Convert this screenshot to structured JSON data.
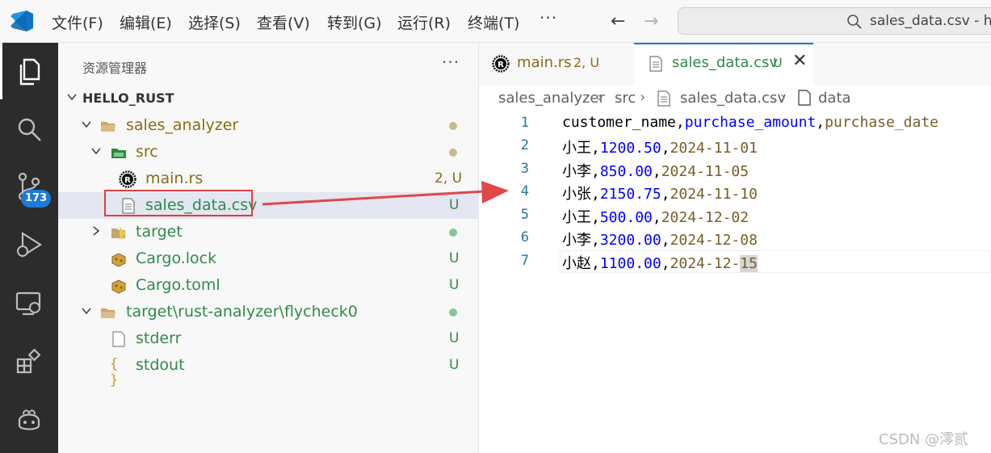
{
  "menu": [
    "文件(F)",
    "编辑(E)",
    "选择(S)",
    "查看(V)",
    "转到(G)",
    "运行(R)",
    "终端(T)"
  ],
  "menu_more": "···",
  "command_center": {
    "text": "sales_data.csv - hel"
  },
  "activity": {
    "scm_badge": "173"
  },
  "explorer": {
    "title": "资源管理器",
    "more": "···",
    "root": "HELLO_RUST",
    "items": [
      {
        "label": "sales_analyzer",
        "status": ""
      },
      {
        "label": "src",
        "status": ""
      },
      {
        "label": "main.rs",
        "status": "2, U"
      },
      {
        "label": "sales_data.csv",
        "status": "U"
      },
      {
        "label": "target",
        "status": ""
      },
      {
        "label": "Cargo.lock",
        "status": "U"
      },
      {
        "label": "Cargo.toml",
        "status": "U"
      },
      {
        "label": "target\\rust-analyzer\\flycheck0",
        "status": ""
      },
      {
        "label": "stderr",
        "status": "U"
      },
      {
        "label": "stdout",
        "status": "U"
      }
    ]
  },
  "tabs": [
    {
      "label": "main.rs",
      "status": "2, U"
    },
    {
      "label": "sales_data.csv",
      "status": "U",
      "close": "✕"
    }
  ],
  "breadcrumb": [
    "sales_analyzer",
    "src",
    "sales_data.csv",
    "data"
  ],
  "editor": {
    "line_numbers": [
      "1",
      "2",
      "3",
      "4",
      "5",
      "6",
      "7"
    ],
    "header": [
      "customer_name",
      "purchase_amount",
      "purchase_date"
    ],
    "rows": [
      [
        "小王",
        "1200.50",
        "2024-11-01"
      ],
      [
        "小李",
        "850.00",
        "2024-11-05"
      ],
      [
        "小张",
        "2150.75",
        "2024-11-10"
      ],
      [
        "小王",
        "500.00",
        "2024-12-02"
      ],
      [
        "小李",
        "3200.00",
        "2024-12-08"
      ],
      [
        "小赵",
        "1100.00",
        "2024-12-15"
      ]
    ]
  },
  "watermark": "CSDN @澪贰",
  "colors": {
    "accent": "#1f77d4",
    "git_untracked": "#2f8a4a",
    "git_modified": "#8a6b14",
    "annotation": "#e03e3e"
  }
}
